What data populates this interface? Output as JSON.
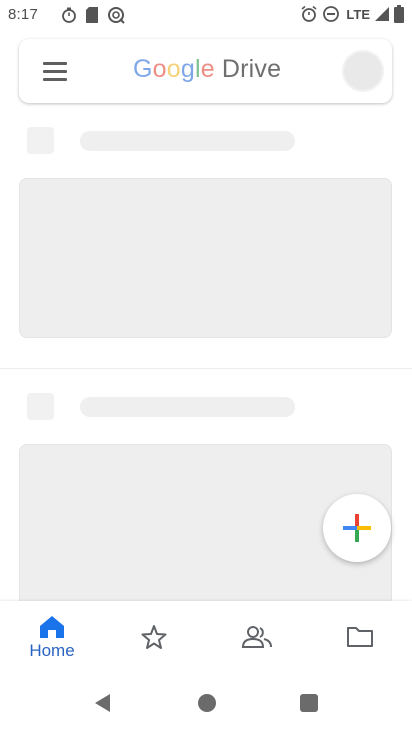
{
  "status_bar": {
    "time": "8:17",
    "network": "LTE",
    "icons": [
      "timer-icon",
      "sd-card-icon",
      "sync-icon",
      "alarm-icon",
      "do-not-disturb-icon",
      "signal-icon",
      "battery-icon"
    ]
  },
  "search_bar": {
    "menu_icon": "hamburger-menu-icon",
    "brand_letters": [
      "G",
      "o",
      "o",
      "g",
      "l",
      "e"
    ],
    "brand_product": "Drive",
    "avatar_state": "loading"
  },
  "content": {
    "state": "loading-placeholders",
    "placeholder_color": "#eeeeee"
  },
  "fab": {
    "icon": "plus-icon",
    "colors": [
      "#ea4335",
      "#fbbc04",
      "#34a853",
      "#4285f4"
    ]
  },
  "bottom_nav": {
    "items": [
      {
        "label": "Home",
        "icon": "home-icon",
        "active": true
      },
      {
        "label": "",
        "icon": "star-icon",
        "active": false
      },
      {
        "label": "",
        "icon": "shared-people-icon",
        "active": false
      },
      {
        "label": "",
        "icon": "folder-icon",
        "active": false
      }
    ],
    "active_color": "#1a73e8"
  },
  "system_nav": {
    "icons": [
      "back-icon",
      "home-circle-icon",
      "recents-icon"
    ]
  }
}
